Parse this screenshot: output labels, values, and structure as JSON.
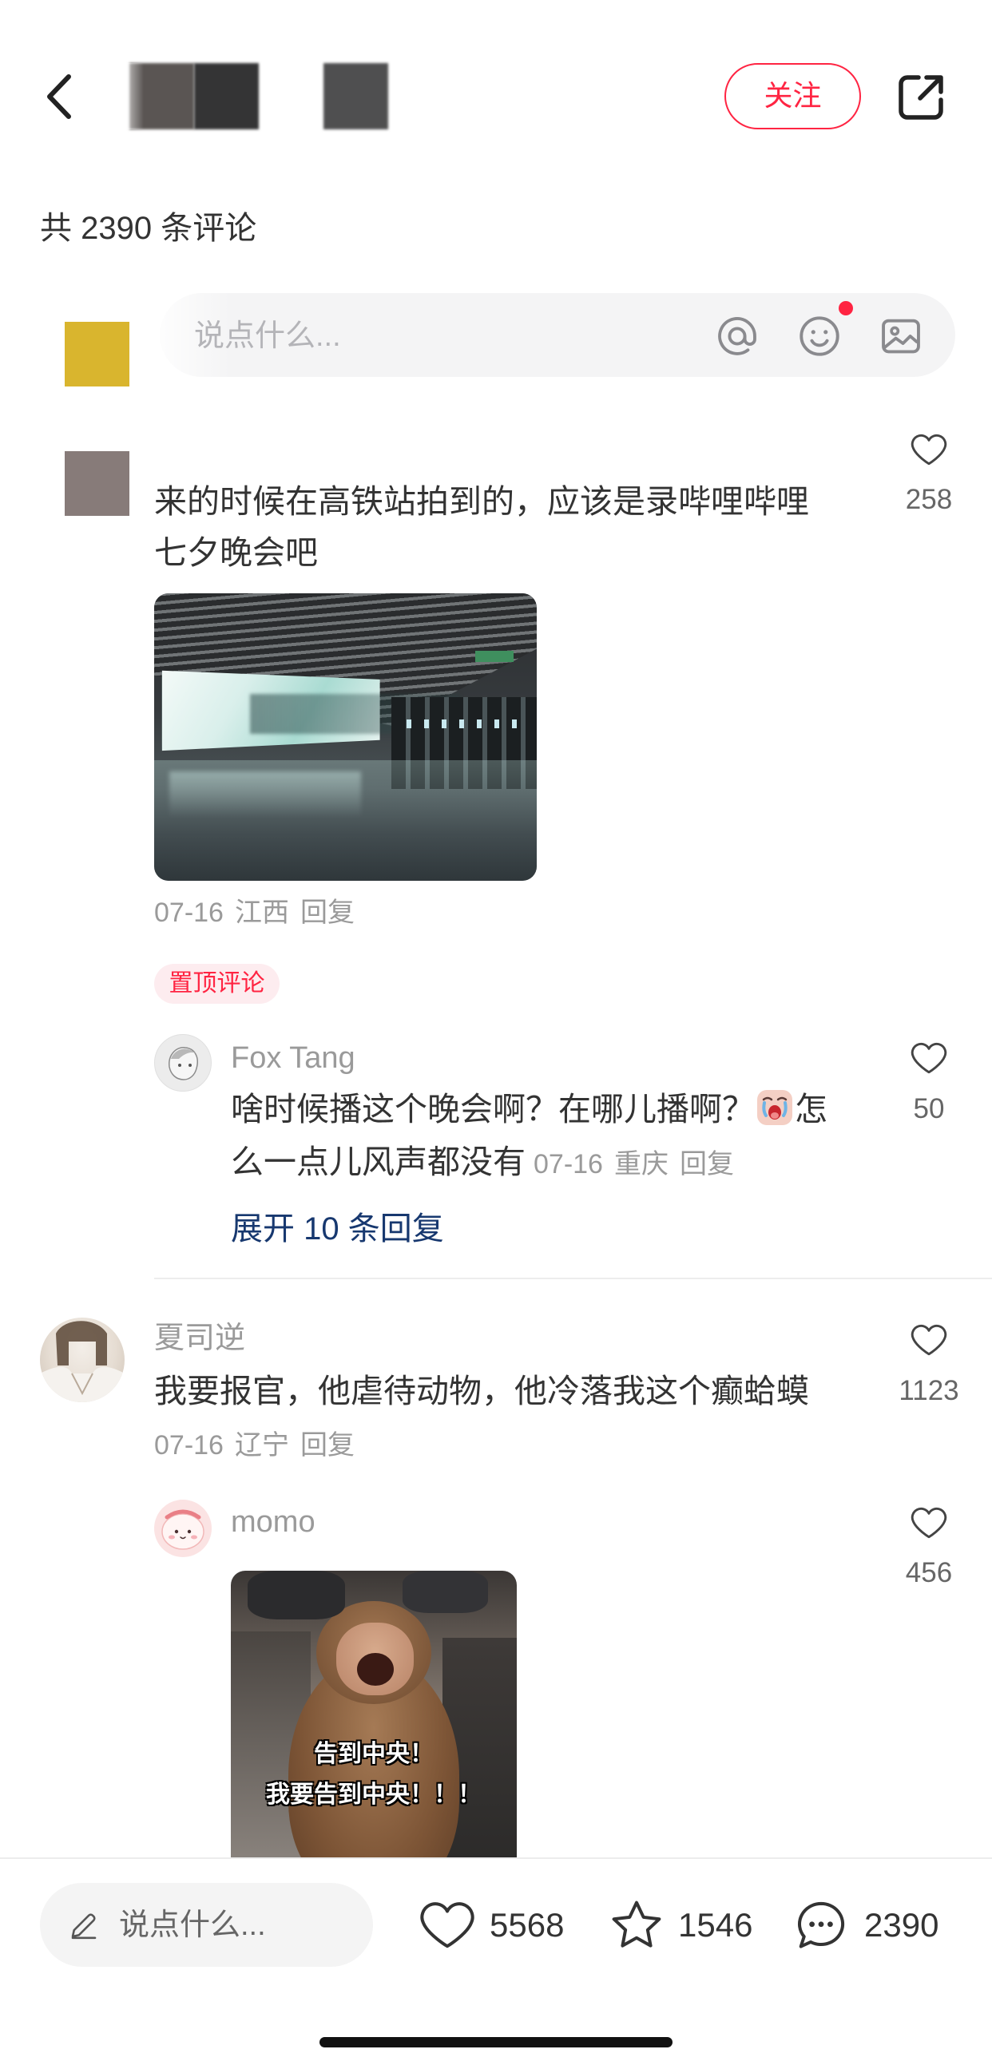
{
  "header": {
    "back_icon": "chevron-left-icon",
    "follow_label": "关注",
    "share_icon": "share-icon",
    "accent_color": "#ff2442"
  },
  "comment_summary": "共 2390 条评论",
  "composer": {
    "placeholder": "说点什么...",
    "icons": [
      "at-icon",
      "emoji-icon",
      "image-icon"
    ],
    "emoji_notification_dot": true
  },
  "comments": [
    {
      "text": "来的时候在高铁站拍到的，应该是录哔哩哔哩七夕晚会吧",
      "likes": "258",
      "date": "07-16",
      "location": "江西",
      "reply_label": "回复",
      "badge": "置顶评论",
      "replies": [
        {
          "author": "Fox Tang",
          "text_before_emoji": "啥时候播这个晚会啊？在哪儿播啊？",
          "emoji": "crying-face-icon",
          "text_after_emoji": "怎么一点儿风声都没有",
          "date": "07-16",
          "location": "重庆",
          "reply_label": "回复",
          "likes": "50"
        }
      ],
      "expand_label": "展开 10 条回复"
    },
    {
      "author": "夏司逆",
      "text": "我要报官，他虐待动物，他冷落我这个癫蛤蟆",
      "date": "07-16",
      "location": "辽宁",
      "reply_label": "回复",
      "likes": "1123",
      "replies": [
        {
          "author": "momo",
          "image_caption": [
            "告到中央！",
            "我要告到中央！！！"
          ],
          "likes": "456"
        }
      ]
    }
  ],
  "bottom_bar": {
    "placeholder": "说点什么...",
    "likes": "5568",
    "collects": "1546",
    "comments": "2390",
    "icons": [
      "pencil-icon",
      "heart-icon",
      "star-icon",
      "comment-bubble-icon"
    ]
  }
}
